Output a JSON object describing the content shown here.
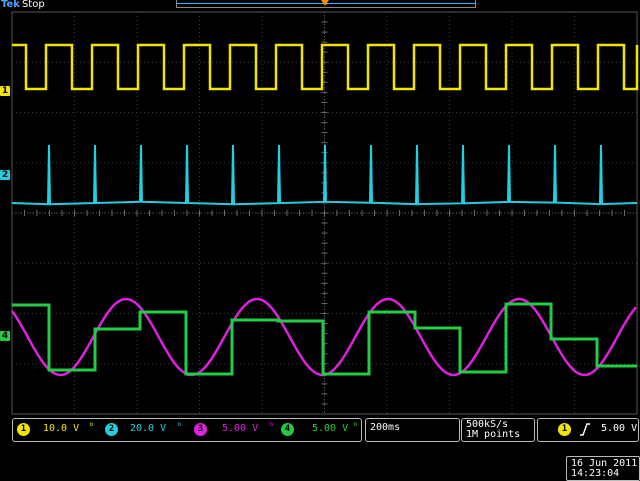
{
  "header": {
    "brand": "Tek",
    "state": "Stop"
  },
  "channel_markers": [
    {
      "id": "1",
      "color": "#f2e600"
    },
    {
      "id": "2",
      "color": "#20d0e0"
    },
    {
      "id": "4",
      "color": "#22cc44"
    }
  ],
  "channels": [
    {
      "id": "1",
      "scale": "10.0 V",
      "color": "#f2e600"
    },
    {
      "id": "2",
      "scale": "20.0 V",
      "color": "#20d0e0"
    },
    {
      "id": "3",
      "scale": "5.00 V",
      "color": "#e020e0"
    },
    {
      "id": "4",
      "scale": "5.00 V",
      "color": "#22cc44"
    }
  ],
  "horizontal": {
    "timebase": "200ms"
  },
  "acquisition": {
    "sample_rate": "500kS/s",
    "record_length": "1M points"
  },
  "trigger": {
    "source": "1",
    "slope": "rising",
    "level": "5.00 V"
  },
  "datetime": {
    "date": "16 Jun 2011",
    "time": "14:23:04"
  }
}
